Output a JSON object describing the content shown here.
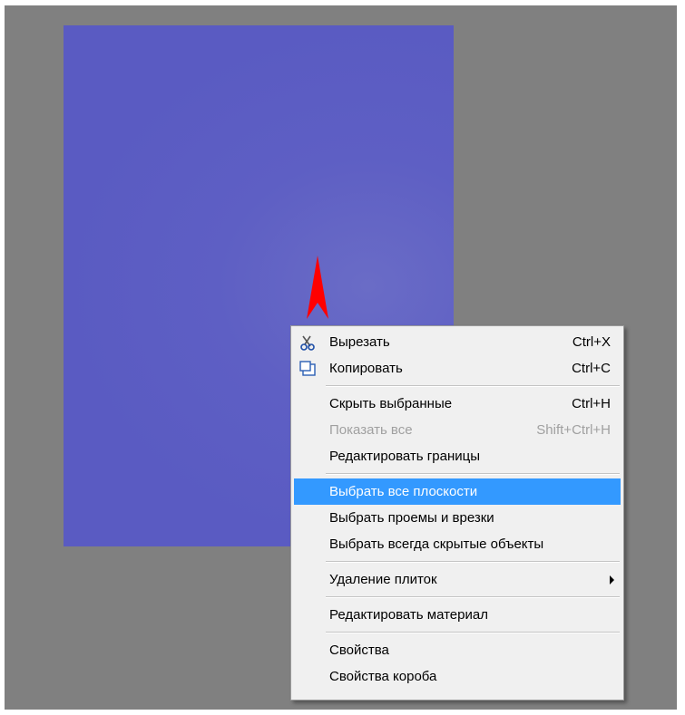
{
  "colors": {
    "viewport_bg": "#808080",
    "panel_bg": "#5e5fc4",
    "arrow": "#ff0000",
    "highlight": "#3399ff",
    "disabled_text": "#a0a0a0"
  },
  "context_menu": {
    "items": [
      {
        "label": "Вырезать",
        "shortcut": "Ctrl+X",
        "icon": "scissors-icon"
      },
      {
        "label": "Копировать",
        "shortcut": "Ctrl+C",
        "icon": "copy-icon"
      },
      {
        "label": "Скрыть выбранные",
        "shortcut": "Ctrl+H"
      },
      {
        "label": "Показать все",
        "shortcut": "Shift+Ctrl+H",
        "disabled": true
      },
      {
        "label": "Редактировать границы",
        "shortcut": ""
      },
      {
        "label": "Выбрать все плоскости",
        "shortcut": "",
        "highlighted": true
      },
      {
        "label": "Выбрать проемы и врезки",
        "shortcut": ""
      },
      {
        "label": "Выбрать всегда скрытые объекты",
        "shortcut": ""
      },
      {
        "label": "Удаление плиток",
        "shortcut": "",
        "submenu": true,
        "icon": "chevron-right-icon"
      },
      {
        "label": "Редактировать материал",
        "shortcut": ""
      },
      {
        "label": "Свойства",
        "shortcut": ""
      },
      {
        "label": "Свойства короба",
        "shortcut": ""
      }
    ]
  }
}
